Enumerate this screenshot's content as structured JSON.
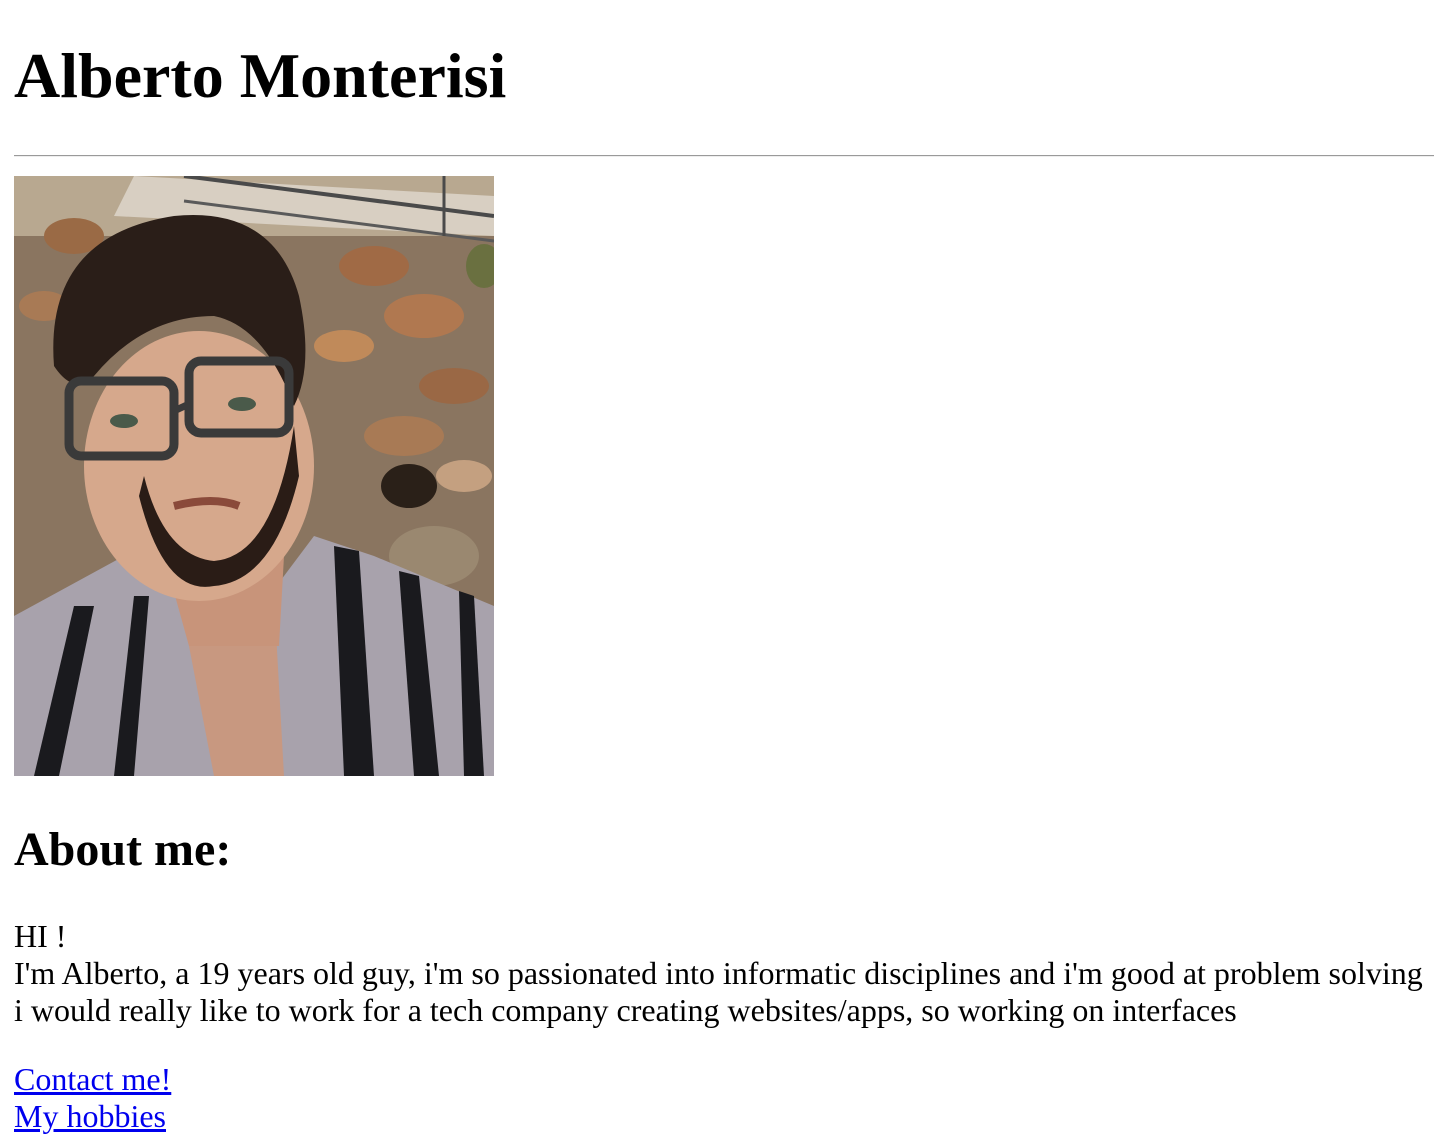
{
  "header": {
    "title": "Alberto Monterisi"
  },
  "photo": {
    "alt": "Portrait of Alberto Monterisi"
  },
  "about": {
    "heading": "About me:",
    "greeting": "HI !",
    "line1": "I'm Alberto, a 19 years old guy, i'm so passionated into informatic disciplines and i'm good at problem solving",
    "line2": "i would really like to work for a tech company creating websites/apps, so working on interfaces"
  },
  "links": {
    "contact": "Contact me!",
    "hobbies": "My hobbies"
  },
  "colors": {
    "link": "#0000ee",
    "text": "#000000",
    "background": "#ffffff"
  }
}
